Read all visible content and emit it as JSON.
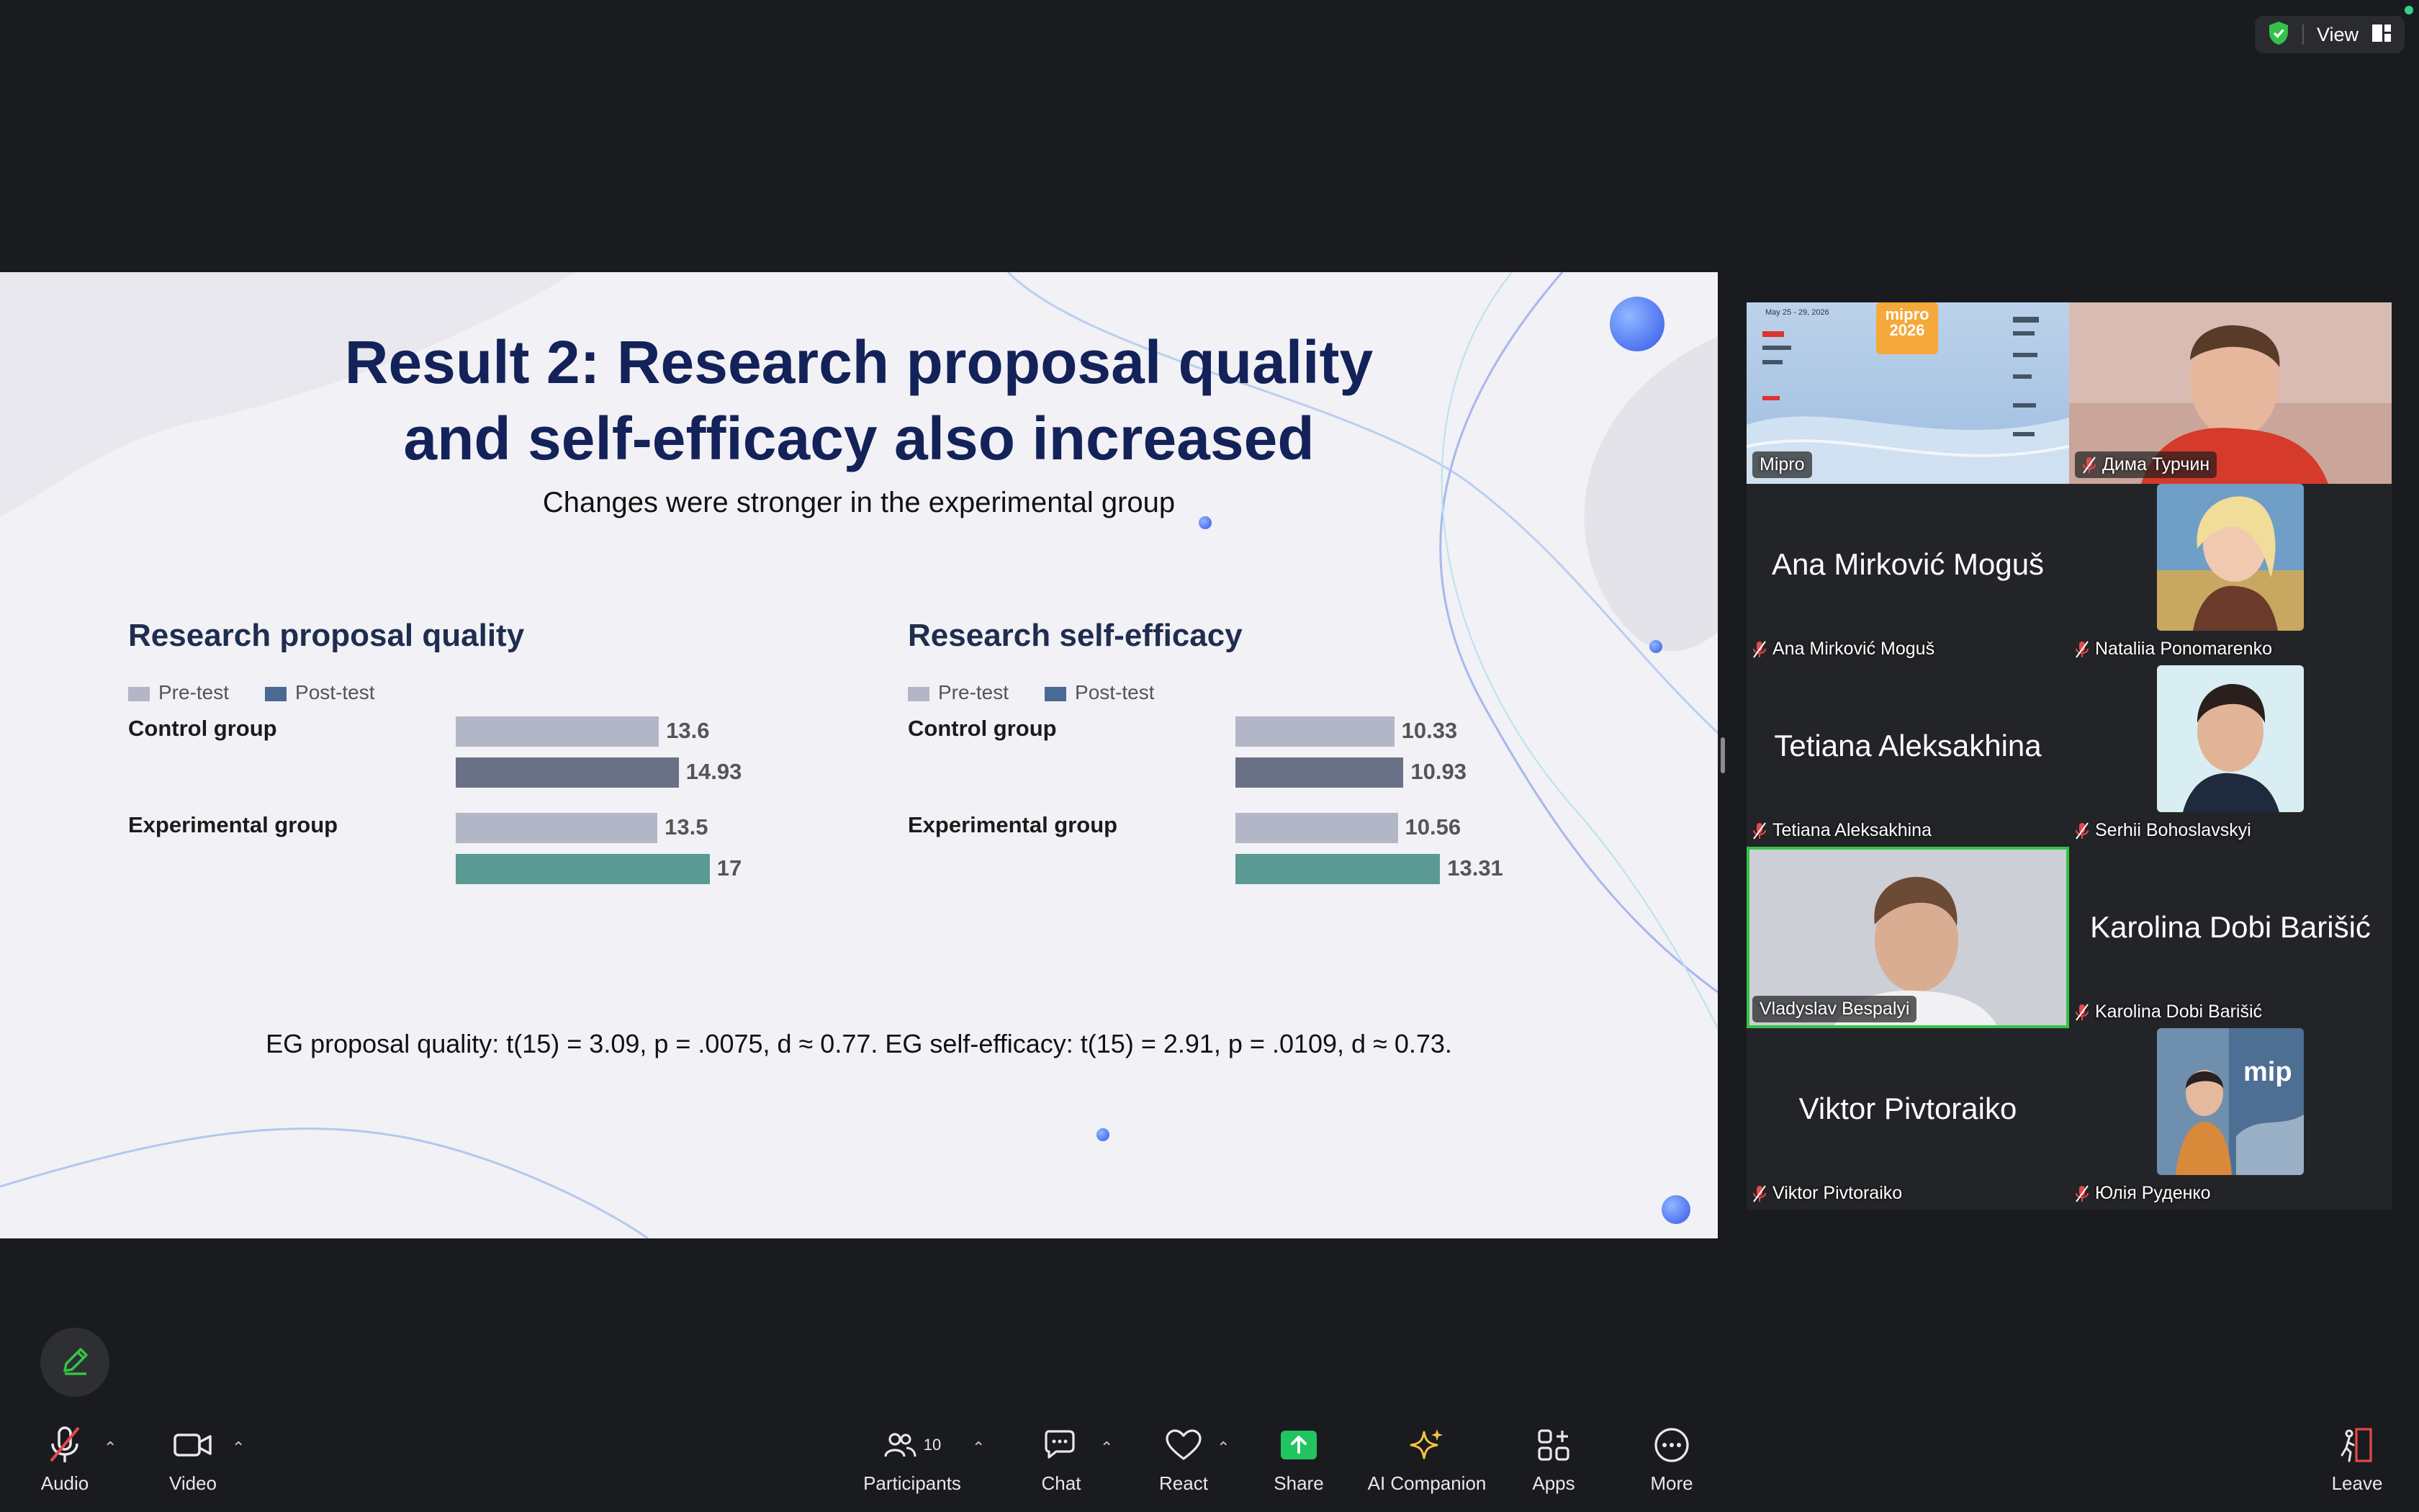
{
  "topbar": {
    "view_label": "View"
  },
  "slide": {
    "title_line1": "Result 2: Research proposal quality",
    "title_line2": "and self-efficacy also increased",
    "subtitle": "Changes were stronger in the experimental group",
    "stats": "EG proposal quality: t(15) = 3.09, p = .0075, d ≈ 0.77. EG self-efficacy: t(15) = 2.91, p = .0109, d ≈ 0.73."
  },
  "chart_data": [
    {
      "type": "bar",
      "orientation": "horizontal",
      "title": "Research proposal quality",
      "categories": [
        "Control group",
        "Experimental group"
      ],
      "series": [
        {
          "name": "Pre-test",
          "values": [
            13.6,
            13.5
          ]
        },
        {
          "name": "Post-test",
          "values": [
            14.93,
            17
          ]
        }
      ],
      "colors": {
        "pre": "#b3b6c6",
        "post_control": "#6a7186",
        "post_experimental": "#5b9a93",
        "legend_post": "#4a6a96"
      },
      "xlim": [
        0,
        20
      ],
      "legend": "top-left"
    },
    {
      "type": "bar",
      "orientation": "horizontal",
      "title": "Research self-efficacy",
      "categories": [
        "Control group",
        "Experimental group"
      ],
      "series": [
        {
          "name": "Pre-test",
          "values": [
            10.33,
            10.56
          ]
        },
        {
          "name": "Post-test",
          "values": [
            10.93,
            13.31
          ]
        }
      ],
      "colors": {
        "pre": "#b3b6c6",
        "post_control": "#6a7186",
        "post_experimental": "#5b9a93",
        "legend_post": "#4a6a96"
      },
      "xlim": [
        0,
        15.5
      ],
      "legend": "top-left"
    }
  ],
  "gallery": {
    "tiles": [
      {
        "name": "Mipro",
        "type": "video",
        "muted": false
      },
      {
        "name": "Дима Турчин",
        "type": "video",
        "muted": true
      },
      {
        "name": "Ana Mirković Moguš",
        "type": "name",
        "muted": true
      },
      {
        "name": "Nataliia Ponomarenko",
        "type": "avatar",
        "muted": true
      },
      {
        "name": "Tetiana Aleksakhina",
        "type": "name",
        "muted": true
      },
      {
        "name": "Serhii Bohoslavskyi",
        "type": "avatar",
        "muted": true
      },
      {
        "name": "Vladyslav Bespalyi",
        "type": "video",
        "muted": false,
        "active": true
      },
      {
        "name": "Karolina Dobi Barišić",
        "type": "name",
        "muted": true
      },
      {
        "name": "Viktor Pivtoraiko",
        "type": "name",
        "muted": true
      },
      {
        "name": "Юлія Руденко",
        "type": "avatar",
        "muted": true
      }
    ],
    "mipro_banner": {
      "date": "May 25 - 29, 2026",
      "logo_line1": "mipro",
      "logo_line2": "2026"
    },
    "rudenko_bg_text": "mip"
  },
  "toolbar": {
    "audio": "Audio",
    "video": "Video",
    "participants": "Participants",
    "participants_count": "10",
    "chat": "Chat",
    "react": "React",
    "share": "Share",
    "ai_companion": "AI Companion",
    "apps": "Apps",
    "more": "More",
    "leave": "Leave"
  },
  "colors": {
    "accent_green": "#35c24a",
    "share_green": "#21c460",
    "leave_red": "#e5484d",
    "ai_yellow": "#f5c542"
  }
}
